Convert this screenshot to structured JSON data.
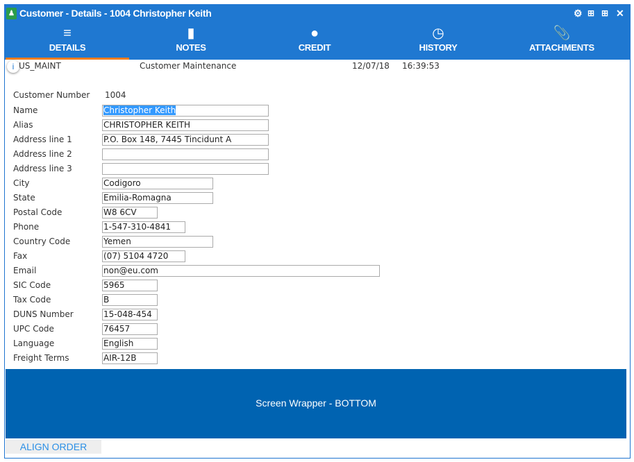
{
  "window": {
    "title": "Customer - Details - 1004 Christopher Keith"
  },
  "tabs": [
    {
      "label": "DETAILS",
      "icon": "list-add-icon"
    },
    {
      "label": "NOTES",
      "icon": "note-icon"
    },
    {
      "label": "CREDIT",
      "icon": "dollar-icon"
    },
    {
      "label": "HISTORY",
      "icon": "clock-icon"
    },
    {
      "label": "ATTACHMENTS",
      "icon": "paperclip-icon"
    }
  ],
  "header": {
    "program": "US_MAINT",
    "description": "Customer Maintenance",
    "date": "12/07/18",
    "time": "16:39:53"
  },
  "form": {
    "customer_number_label": "Customer Number",
    "customer_number": "1004",
    "fields": [
      {
        "label": "Name",
        "value": "Christopher Keith"
      },
      {
        "label": "Alias",
        "value": "CHRISTOPHER KEITH"
      },
      {
        "label": "Address line 1",
        "value": "P.O. Box 148, 7445 Tincidunt A"
      },
      {
        "label": "Address line 2",
        "value": ""
      },
      {
        "label": "Address line 3",
        "value": ""
      },
      {
        "label": "City",
        "value": "Codigoro"
      },
      {
        "label": "State",
        "value": "Emilia-Romagna"
      },
      {
        "label": "Postal Code",
        "value": "W8 6CV"
      },
      {
        "label": "Phone",
        "value": "1-547-310-4841"
      },
      {
        "label": "Country Code",
        "value": "Yemen"
      },
      {
        "label": "Fax",
        "value": "(07) 5104 4720"
      },
      {
        "label": "Email",
        "value": "non@eu.com"
      },
      {
        "label": "SIC Code",
        "value": "5965"
      },
      {
        "label": "Tax Code",
        "value": "B"
      },
      {
        "label": "DUNS Number",
        "value": "15-048-454"
      },
      {
        "label": "UPC Code",
        "value": "76457"
      },
      {
        "label": "Language",
        "value": "English"
      },
      {
        "label": "Freight Terms",
        "value": "AIR-12B"
      }
    ]
  },
  "bottom": {
    "label": "Screen Wrapper - BOTTOM"
  },
  "align_order": "ALIGN ORDER"
}
